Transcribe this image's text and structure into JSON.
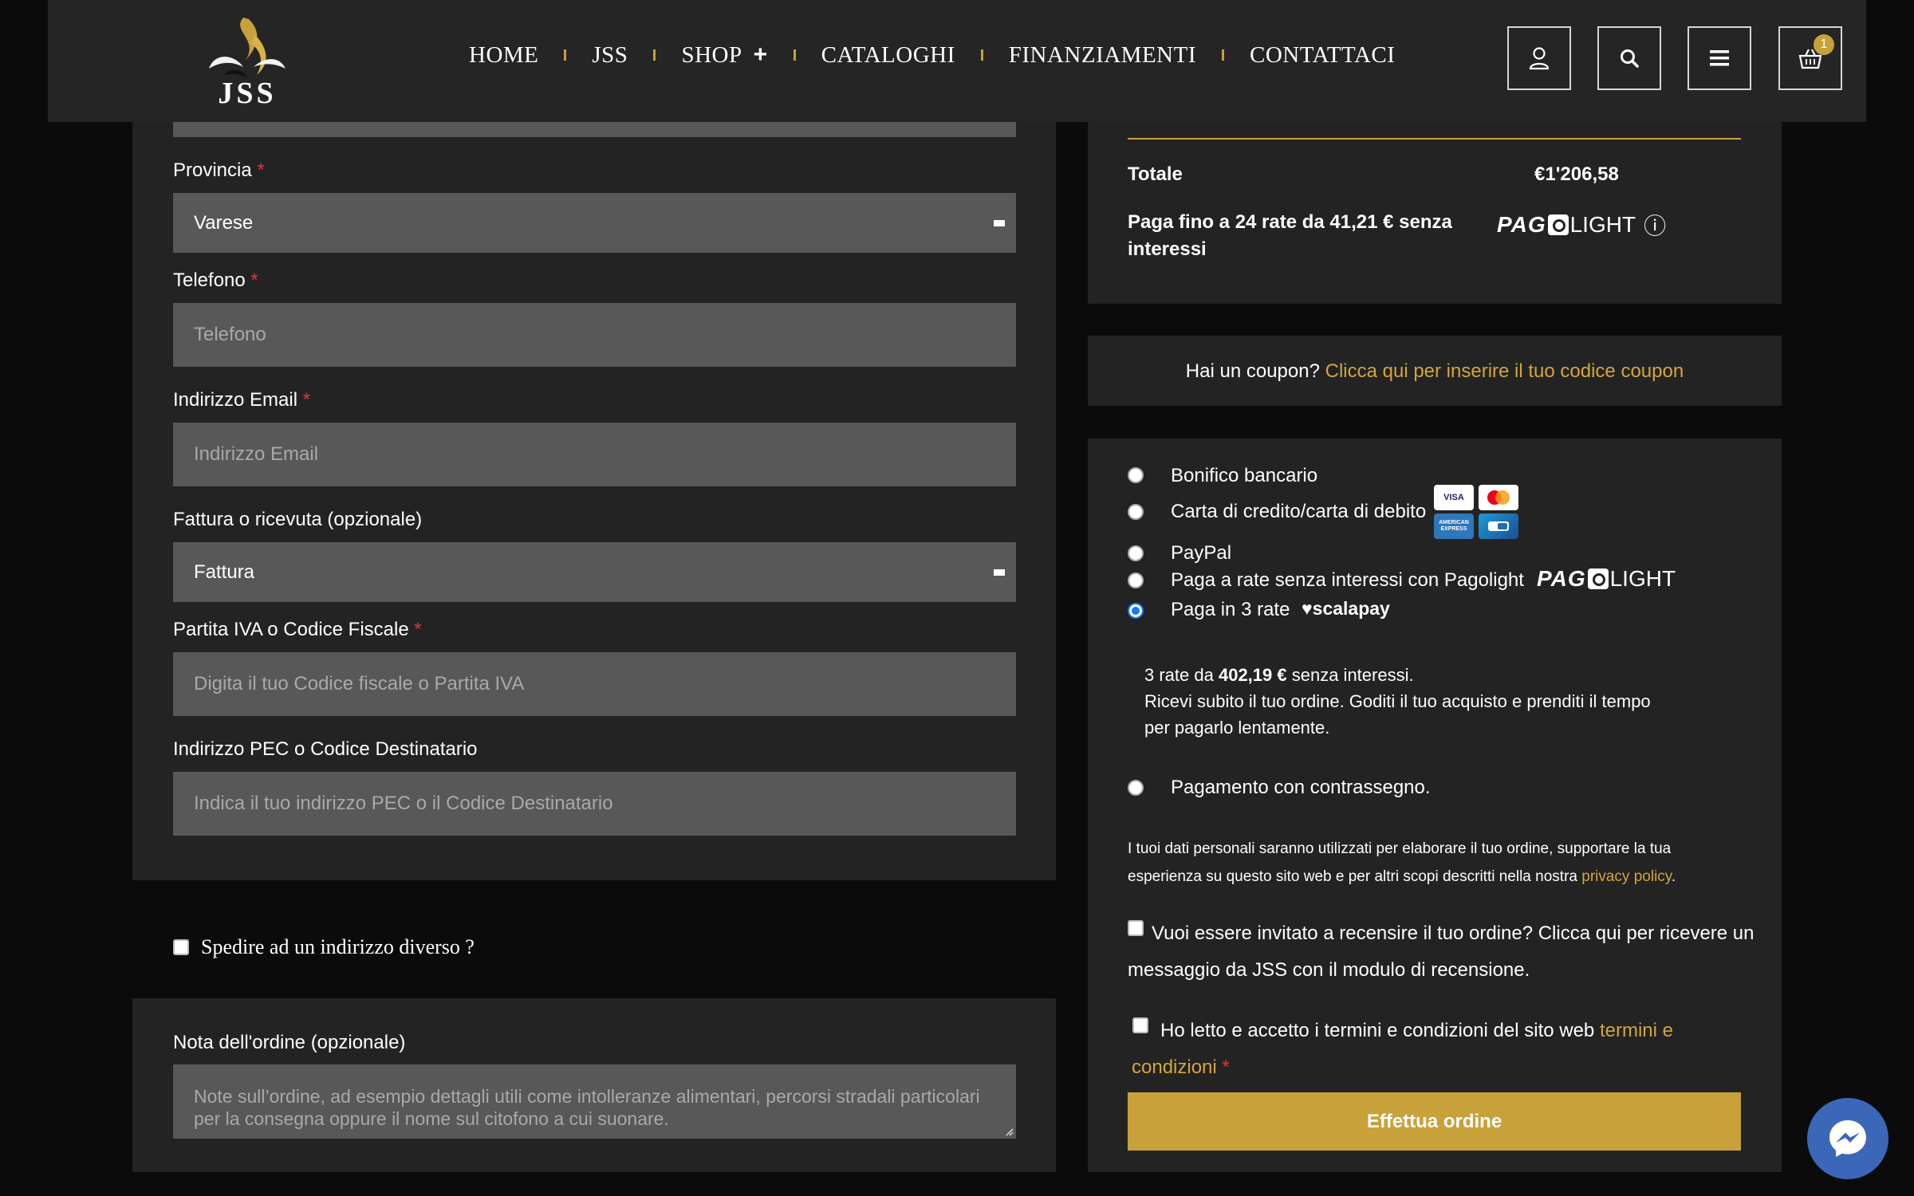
{
  "header": {
    "logo_text": "JSS",
    "nav": [
      {
        "label": "HOME"
      },
      {
        "label": "JSS"
      },
      {
        "label": "SHOP",
        "plus": "+"
      },
      {
        "label": "CATALOGHI"
      },
      {
        "label": "FINANZIAMENTI"
      },
      {
        "label": "CONTATTACI"
      }
    ],
    "cart_count": "1",
    "icons": [
      "user-icon",
      "search-icon",
      "menu-icon",
      "basket-icon"
    ]
  },
  "billing": {
    "provincia": {
      "label": "Provincia",
      "value": "Varese"
    },
    "telefono": {
      "label": "Telefono",
      "placeholder": "Telefono"
    },
    "email": {
      "label": "Indirizzo Email",
      "placeholder": "Indirizzo Email"
    },
    "fattura": {
      "label": "Fattura o ricevuta (opzionale)",
      "value": "Fattura"
    },
    "piva": {
      "label": "Partita IVA o Codice Fiscale",
      "placeholder": "Digita il tuo Codice fiscale o Partita IVA"
    },
    "pec": {
      "label": "Indirizzo PEC o Codice Destinatario",
      "placeholder": "Indica il tuo indirizzo PEC o il Codice Destinatario"
    },
    "required_mark": "*"
  },
  "ship_different": "Spedire ad un indirizzo diverso ?",
  "order_note": {
    "label": "Nota dell'ordine (opzionale)",
    "placeholder": "Note sull’ordine, ad esempio dettagli utili come intolleranze alimentari, percorsi stradali particolari per la consegna oppure il nome sul citofono a cui suonare."
  },
  "summary": {
    "total_label": "Totale",
    "total_value": "€1'206,58",
    "pago_line1": "Paga fino a 24 rate da 41,21 € senza",
    "pago_line2": "interessi",
    "pago_logo": {
      "a": "PAG",
      "c": "LIGHT"
    },
    "info_icon": "ⓘ"
  },
  "coupon": {
    "text": "Hai un coupon?",
    "link": "Clicca qui per inserire il tuo codice coupon"
  },
  "payment": {
    "methods": [
      {
        "label": "Bonifico bancario",
        "checked": false
      },
      {
        "label": "Carta di credito/carta di debito",
        "checked": false
      },
      {
        "label": "PayPal",
        "checked": false
      },
      {
        "label": "Paga a rate senza interessi con Pagolight",
        "checked": false
      },
      {
        "label": "Paga in 3 rate",
        "checked": true
      }
    ],
    "cards": [
      "VISA",
      "AMERICAN EXPRESS"
    ],
    "scalapay_logo": "♥scalapay",
    "scalapay_desc": {
      "pre": "3 rate da",
      "amount": "402,19 €",
      "post": "senza interessi.",
      "line2": "Ricevi subito il tuo ordine. Goditi il tuo acquisto e prenditi il tempo",
      "line3": "per pagarlo lentamente."
    },
    "cod": {
      "label": "Pagamento con contrassegno.",
      "checked": false
    }
  },
  "privacy": {
    "line1": "I tuoi dati personali saranno utilizzati per elaborare il tuo ordine, supportare la tua",
    "line2_pre": "esperienza su questo sito web e per altri scopi descritti nella nostra",
    "link": "privacy policy",
    "end": "."
  },
  "review": {
    "line1": "Vuoi essere invitato a recensire il tuo ordine? Clicca qui per ricevere un",
    "line2": "messaggio da JSS con il modulo di recensione."
  },
  "terms": {
    "pre": "Ho letto e accetto i termini e condizioni del sito web",
    "link1": "termini e",
    "link2": "condizioni",
    "req": "*"
  },
  "order_button": "Effettua ordine",
  "colors": {
    "accent": "#c9a13b",
    "field": "#585858",
    "panel": "#232323",
    "background": "#0b0b0b"
  }
}
